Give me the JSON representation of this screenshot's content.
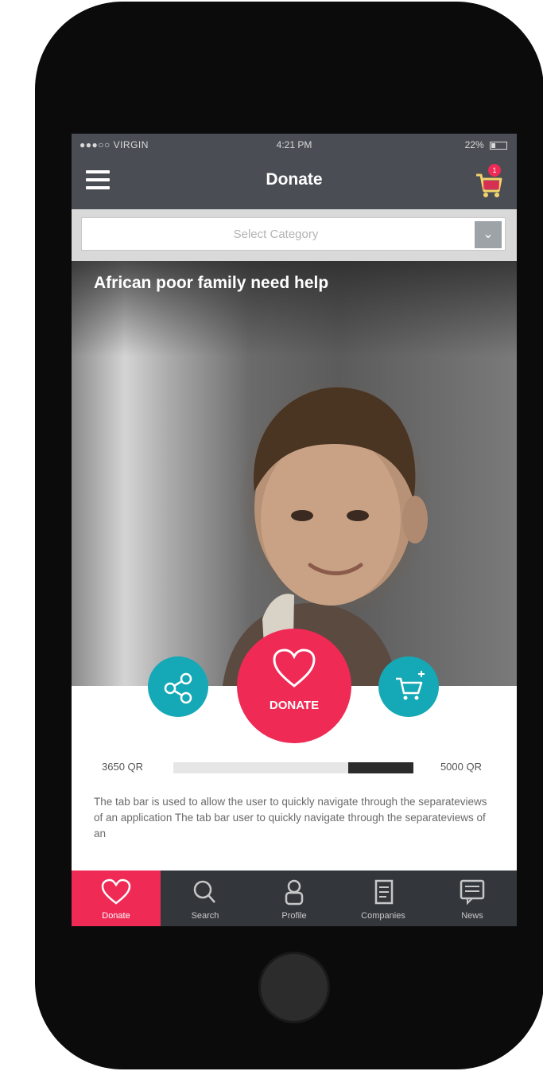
{
  "status_bar": {
    "carrier": "●●●○○ VIRGIN",
    "time": "4:21 PM",
    "battery": "22%"
  },
  "nav": {
    "title": "Donate",
    "cart_badge": "1"
  },
  "category_select": {
    "placeholder": "Select Category"
  },
  "campaign": {
    "title": "African poor family need help",
    "donate_label": "DONATE",
    "raised": "3650 QR",
    "goal": "5000 QR",
    "progress_fraction": 0.27,
    "description": "The tab bar is used to allow the user to quickly navigate through the separateviews of an application The tab bar user to quickly navigate through the separateviews of an"
  },
  "colors": {
    "accent": "#ee2a55",
    "teal": "#15a8b6",
    "bar": "#4a4e54",
    "tabbar": "#33373c"
  },
  "tabs": [
    {
      "label": "Donate",
      "icon": "heart-icon",
      "active": true
    },
    {
      "label": "Search",
      "icon": "search-icon",
      "active": false
    },
    {
      "label": "Profile",
      "icon": "profile-icon",
      "active": false
    },
    {
      "label": "Companies",
      "icon": "document-icon",
      "active": false
    },
    {
      "label": "News",
      "icon": "news-icon",
      "active": false
    }
  ]
}
